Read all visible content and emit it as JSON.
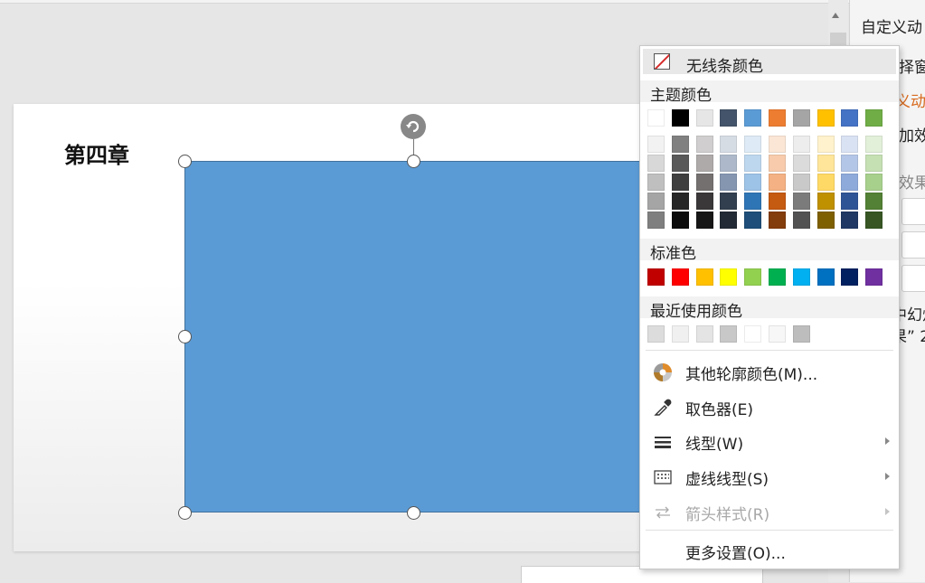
{
  "slide": {
    "chapter_title": "第四章",
    "shape_fill": "#5b9bd5"
  },
  "right_pane": {
    "title": "自定义动",
    "line2": "择窗",
    "line3": "义动",
    "line4": "加效",
    "line5": "效果",
    "line6": "中幻灯",
    "line7": "果” 2"
  },
  "menu": {
    "no_line_label": "无线条颜色",
    "theme_colors_label": "主题颜色",
    "theme_top_row": [
      "#ffffff",
      "#000000",
      "#e7e6e6",
      "#44546a",
      "#5b9bd5",
      "#ed7d31",
      "#a5a5a5",
      "#ffc000",
      "#4472c4",
      "#70ad47"
    ],
    "theme_shades": [
      [
        "#f2f2f2",
        "#808080",
        "#d0cece",
        "#d6dce4",
        "#deebf6",
        "#fbe5d5",
        "#ededed",
        "#fff2cc",
        "#d9e2f3",
        "#e2efd9"
      ],
      [
        "#d8d8d8",
        "#595959",
        "#aeaaaa",
        "#adb9ca",
        "#bdd7ee",
        "#f7cbac",
        "#dbdbdb",
        "#fee599",
        "#b4c6e7",
        "#c5e0b3"
      ],
      [
        "#bfbfbf",
        "#3f3f3f",
        "#757070",
        "#8496b0",
        "#9dc3e6",
        "#f4b183",
        "#c9c9c9",
        "#ffd965",
        "#8eaadb",
        "#a8d08d"
      ],
      [
        "#a5a5a5",
        "#262626",
        "#3a3838",
        "#323f4f",
        "#2e75b5",
        "#c55a11",
        "#7b7b7b",
        "#bf9000",
        "#2f5496",
        "#538135"
      ],
      [
        "#7f7f7f",
        "#0c0c0c",
        "#171616",
        "#222a35",
        "#1e4e79",
        "#833c0b",
        "#525252",
        "#7f6000",
        "#1f3864",
        "#375623"
      ]
    ],
    "standard_colors_label": "标准色",
    "standard_colors": [
      "#c00000",
      "#ff0000",
      "#ffc000",
      "#ffff00",
      "#92d050",
      "#00b050",
      "#00b0f0",
      "#0070c0",
      "#002060",
      "#7030a0"
    ],
    "recent_colors_label": "最近使用颜色",
    "recent_colors": [
      "#dcdcdc",
      "#f0f0f0",
      "#e4e4e4",
      "#c8c8c8",
      "#ffffff",
      "#f7f7f7",
      "#bdbdbd"
    ],
    "items": [
      {
        "label": "其他轮廓颜色(M)...",
        "icon": "color-wheel-icon"
      },
      {
        "label": "取色器(E)",
        "icon": "eyedropper-icon"
      },
      {
        "label": "线型(W)",
        "icon": "line-weight-icon"
      },
      {
        "label": "虚线线型(S)",
        "icon": "dash-type-icon"
      },
      {
        "label": "箭头样式(R)",
        "icon": "arrow-style-icon"
      },
      {
        "label": "更多设置(O)..."
      }
    ]
  }
}
